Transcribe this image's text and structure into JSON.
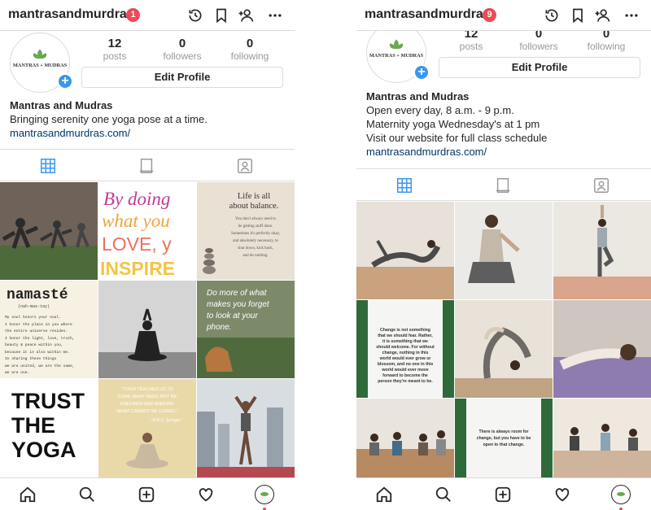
{
  "left": {
    "username": "mantrasandmurdras",
    "notification_count": "1",
    "avatar_logo_text": "MANTRAS + MUDRAS",
    "stats": [
      {
        "value": "12",
        "label": "posts"
      },
      {
        "value": "0",
        "label": "followers"
      },
      {
        "value": "0",
        "label": "following"
      }
    ],
    "edit_profile_label": "Edit Profile",
    "bio": {
      "name": "Mantras and Mudras",
      "lines": [
        "Bringing serenity one yoga pose at a time."
      ],
      "link": "mantrasandmurdras.com/"
    },
    "posts": {
      "p2": [
        "By doing",
        "what you",
        "LOVE, y",
        "INSPIRE"
      ],
      "p3": [
        "Life is all",
        "about balance.",
        "You don't always need to",
        "be getting stuff done.",
        "Sometimes it's perfectly okay,",
        "and absolutely necessary, to",
        "shut down, kick back,",
        "and do nothing."
      ],
      "p4": [
        "namasté",
        "(nah-mas-tay)",
        "My soul honors your soul.",
        "I honor the place in you where",
        "the entire universe resides.",
        "I honor the light, love, truth,",
        "beauty & peace within you,",
        "because it is also within me.",
        "In sharing these things",
        "we are united, we are the same,",
        "we are one."
      ],
      "p6": [
        "Do more of what",
        "makes you forget",
        "to look at your",
        "phone."
      ],
      "p7": [
        "TRUST",
        "THE",
        "YOGA"
      ],
      "p8": [
        "\"YOGA TEACHES US TO",
        "CURE WHAT NEED NOT BE",
        "ENDURED AND ENDURE",
        "WHAT CANNOT BE CURED.\"",
        "- B.K.S. Iyengar"
      ]
    }
  },
  "right": {
    "username": "mantrasandmurdras",
    "notification_count": "9",
    "avatar_logo_text": "MANTRAS + MUDRAS",
    "stats": [
      {
        "value": "12",
        "label": "posts"
      },
      {
        "value": "0",
        "label": "followers"
      },
      {
        "value": "0",
        "label": "following"
      }
    ],
    "edit_profile_label": "Edit Profile",
    "bio": {
      "name": "Mantras and Mudras",
      "lines": [
        "Open every day, 8 a.m. - 9 p.m.",
        "Maternity yoga Wednesday's at 1 pm",
        "Visit our website for full class schedule"
      ],
      "link": "mantrasandmurdras.com/"
    },
    "posts": {
      "q4": [
        "Change is not something",
        "that we should fear. Rather,",
        "it is something that we",
        "should welcome. For without",
        "change, nothing in this",
        "world would ever grow or",
        "blossom, and no one in this",
        "world would ever move",
        "forward to become the",
        "person they're meant to be."
      ],
      "q8": [
        "There is always room for",
        "change, but you have to be",
        "open to that change."
      ]
    }
  },
  "colors": {
    "accent": "#3897f0",
    "badge": "#ed4956",
    "link": "#003569",
    "border": "#dbdbdb",
    "muted": "#999999",
    "logo_green": "#6aa84f"
  },
  "icons": [
    "history-icon",
    "bookmark-icon",
    "add-person-icon",
    "more-icon",
    "grid-icon",
    "feed-icon",
    "tagged-icon",
    "home-icon",
    "search-icon",
    "add-post-icon",
    "heart-icon",
    "profile-icon"
  ]
}
